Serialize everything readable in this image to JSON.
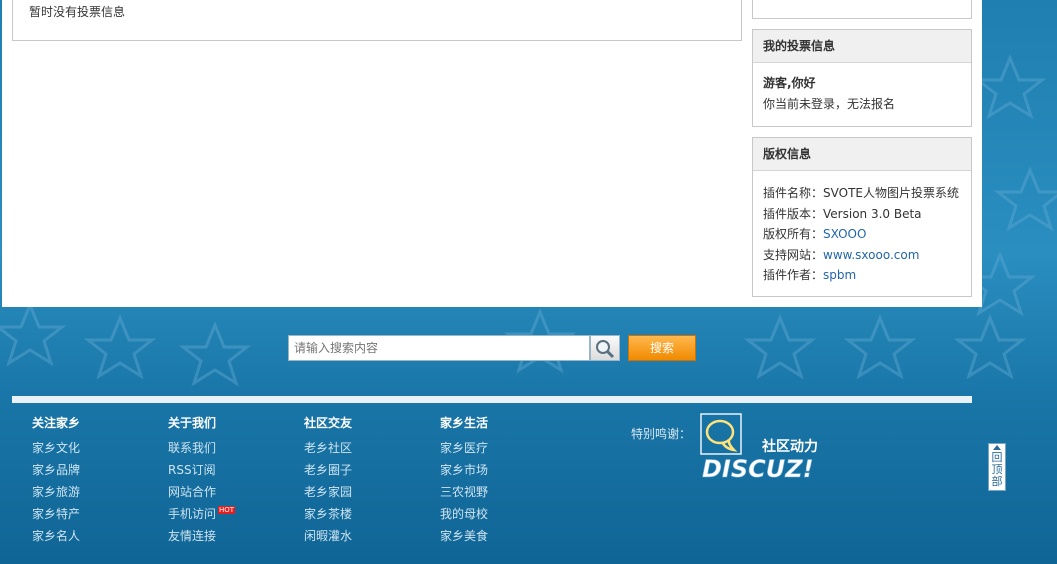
{
  "main": {
    "empty_text": "暂时没有投票信息"
  },
  "sidebar": {
    "vote_info": {
      "title": "我的投票信息",
      "greeting": "游客,你好",
      "message": "你当前未登录，无法报名"
    },
    "copyright": {
      "title": "版权信息",
      "rows": [
        {
          "label": "插件名称：",
          "value": "SVOTE人物图片投票系统",
          "link": false
        },
        {
          "label": "插件版本：",
          "value": "Version 3.0 Beta",
          "link": false
        },
        {
          "label": "版权所有：",
          "value": "SXOOO",
          "link": true
        },
        {
          "label": "支持网站：",
          "value": "www.sxooo.com",
          "link": true
        },
        {
          "label": "插件作者：",
          "value": "spbm",
          "link": true
        }
      ]
    }
  },
  "search": {
    "placeholder": "请输入搜索内容",
    "button_label": "搜索"
  },
  "footer": {
    "columns": [
      {
        "title": "关注家乡",
        "items": [
          "家乡文化",
          "家乡品牌",
          "家乡旅游",
          "家乡特产",
          "家乡名人"
        ]
      },
      {
        "title": "关于我们",
        "items": [
          "联系我们",
          "RSS订阅",
          "网站合作",
          "手机访问",
          "友情连接"
        ]
      },
      {
        "title": "社区交友",
        "items": [
          "老乡社区",
          "老乡圈子",
          "老乡家园",
          "家乡茶楼",
          "闲暇灌水"
        ]
      },
      {
        "title": "家乡生活",
        "items": [
          "家乡医疗",
          "家乡市场",
          "三农视野",
          "我的母校",
          "家乡美食"
        ]
      }
    ],
    "hot_badge": "HOT",
    "thanks_label": "特别鸣谢：",
    "discuz": {
      "tagline": "社区动力",
      "name": "DISCUZ!"
    }
  },
  "backtop": {
    "label": "回顶部"
  },
  "colors": {
    "accent": "#f08a00",
    "link": "#2266aa",
    "background": "#1f7fb0"
  }
}
